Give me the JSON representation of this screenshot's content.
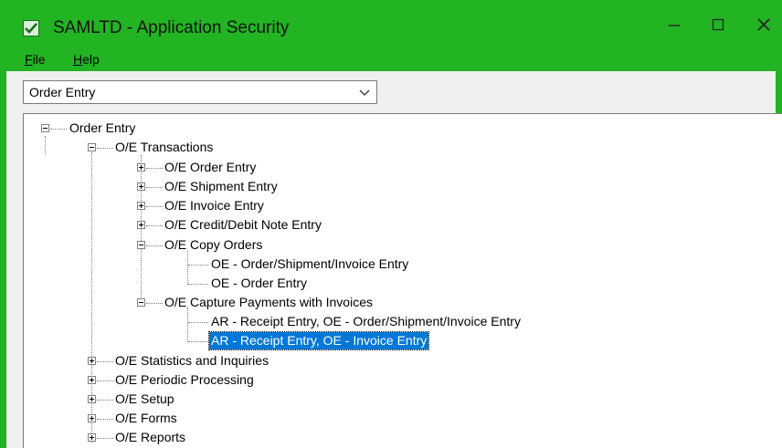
{
  "window": {
    "title": "SAMLTD - Application Security",
    "accent_color": "#22b422",
    "controls": {
      "minimize": "minimize-icon",
      "maximize": "maximize-icon",
      "close": "close-icon"
    }
  },
  "menu": {
    "file": {
      "key": "F",
      "rest": "ile"
    },
    "help": {
      "key": "H",
      "rest": "elp"
    }
  },
  "module_select": {
    "value": "Order Entry"
  },
  "tree": {
    "root": "Order Entry",
    "transactions": "O/E Transactions",
    "order_entry": "O/E Order Entry",
    "shipment_entry": "O/E Shipment Entry",
    "invoice_entry": "O/E Invoice Entry",
    "credit_debit": "O/E Credit/Debit Note Entry",
    "copy_orders": "O/E Copy Orders",
    "copy_ship_inv": "OE - Order/Shipment/Invoice Entry",
    "copy_order": "OE - Order Entry",
    "capture_payments": "O/E Capture Payments with Invoices",
    "cap_ar_ship_inv": "AR - Receipt Entry, OE - Order/Shipment/Invoice Entry",
    "cap_ar_invoice": "AR - Receipt Entry, OE - Invoice Entry",
    "statistics": "O/E Statistics and Inquiries",
    "periodic": "O/E Periodic Processing",
    "setup": "O/E Setup",
    "forms": "O/E Forms",
    "reports": "O/E Reports"
  }
}
